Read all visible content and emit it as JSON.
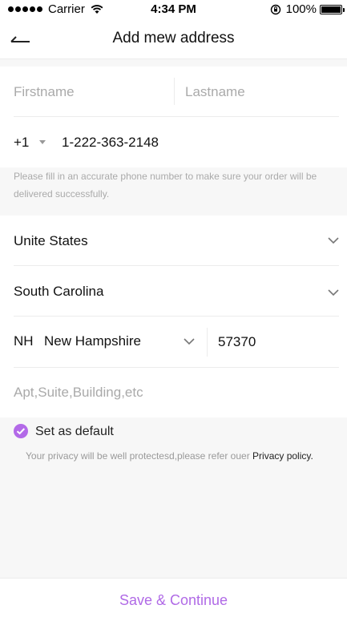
{
  "status_bar": {
    "carrier": "Carrier",
    "time": "4:34 PM",
    "battery": "100%"
  },
  "nav": {
    "title": "Add mew address"
  },
  "form": {
    "firstname_placeholder": "Firstname",
    "lastname_placeholder": "Lastname",
    "country_code": "+1",
    "phone": "1-222-363-2148",
    "phone_note": "Please fill in an accurate phone number to make sure your order will be delivered successfully.",
    "country": "Unite States",
    "state": "South Carolina",
    "city_code": "NH",
    "city": "New Hampshire",
    "zip": "57370",
    "apt_placeholder": "Apt,Suite,Building,etc"
  },
  "default_label": "Set as default",
  "privacy": {
    "text": "Your privacy will be well protectesd,please refer ouer ",
    "link": "Privacy policy."
  },
  "footer": {
    "button": "Save & Continue"
  },
  "colors": {
    "accent": "#b06ae6"
  }
}
